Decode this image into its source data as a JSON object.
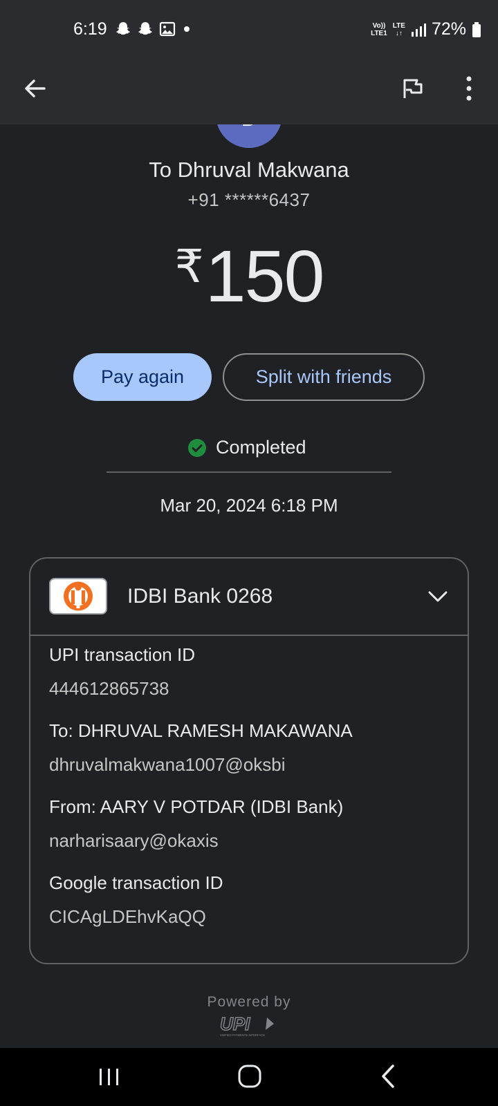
{
  "status_bar": {
    "time": "6:19",
    "network_top": "Vo))",
    "network_bottom": "LTE1",
    "lte": "LTE",
    "battery": "72%"
  },
  "app_bar": {
    "back_icon": "arrow-left-icon",
    "flag_icon": "flag-icon",
    "more_icon": "more-vert-icon"
  },
  "transaction": {
    "avatar_letter": "D",
    "recipient": "To Dhruval Makwana",
    "phone": "+91 ******6437",
    "currency": "₹",
    "amount": "150",
    "pay_again": "Pay again",
    "split": "Split with friends",
    "status": "Completed",
    "datetime": "Mar 20, 2024 6:18 PM"
  },
  "card": {
    "bank_name": "IDBI Bank 0268",
    "details": [
      {
        "label": "UPI transaction ID",
        "value": "444612865738"
      },
      {
        "label": "To: DHRUVAL RAMESH MAKAWANA",
        "value": "dhruvalmakwana1007@oksbi"
      },
      {
        "label": "From: AARY V POTDAR (IDBI Bank)",
        "value": "narharisaary@okaxis"
      },
      {
        "label": "Google transaction ID",
        "value": "CICAgLDEhvKaQQ"
      }
    ]
  },
  "footer": {
    "powered_by": "Powered by",
    "upi_logo": "UPI",
    "upi_tagline": "UNIFIED PAYMENTS INTERFACE"
  },
  "colors": {
    "background": "#202124",
    "accent": "#a8c7fa",
    "success": "#1e8e3e",
    "bank_orange": "#f37021"
  }
}
